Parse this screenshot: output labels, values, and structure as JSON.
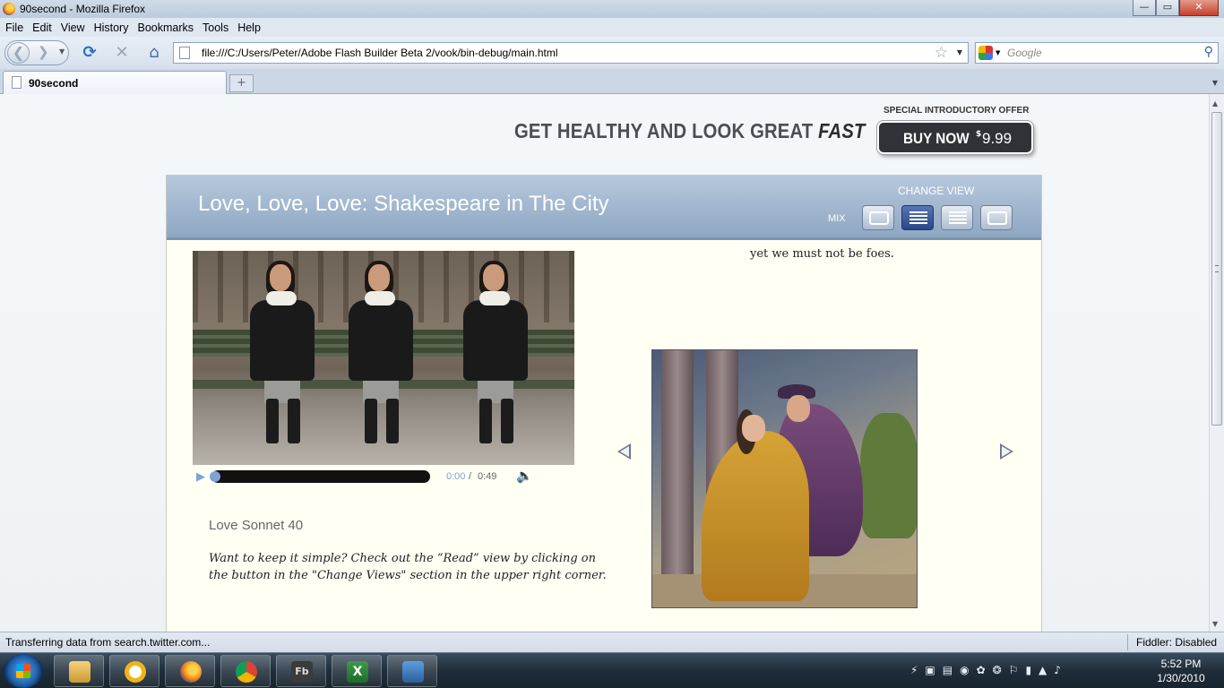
{
  "window": {
    "title": "90second - Mozilla Firefox"
  },
  "menu": [
    "File",
    "Edit",
    "View",
    "History",
    "Bookmarks",
    "Tools",
    "Help"
  ],
  "toolbar": {
    "url": "file:///C:/Users/Peter/Adobe Flash Builder Beta 2/vook/bin-debug/main.html",
    "search_placeholder": "Google"
  },
  "tabs": [
    {
      "label": "90second"
    }
  ],
  "page": {
    "headline": "GET HEALTHY AND LOOK GREAT",
    "headline_em": "FAST",
    "offer": "SPECIAL INTRODUCTORY OFFER",
    "buy_label": "BUY NOW",
    "buy_currency": "$",
    "buy_price": "9.99",
    "book_title": "Love, Love, Love: Shakespeare in The City",
    "change_view": "CHANGE VIEW",
    "mix": "MIX",
    "video": {
      "time_current": "0:00",
      "time_sep": "/",
      "time_total": "0:49",
      "progress": 0
    },
    "sonnet_title": "Love Sonnet 40",
    "tip": "Want to keep it simple? Check out the “Read” view by clicking on the button in the \"Change Views\" section in the upper right corner.",
    "verse": "yet we must not be foes."
  },
  "status": {
    "text": "Transferring data from search.twitter.com...",
    "fiddler": "Fiddler: Disabled"
  },
  "clock": {
    "time": "5:52 PM",
    "date": "1/30/2010"
  }
}
